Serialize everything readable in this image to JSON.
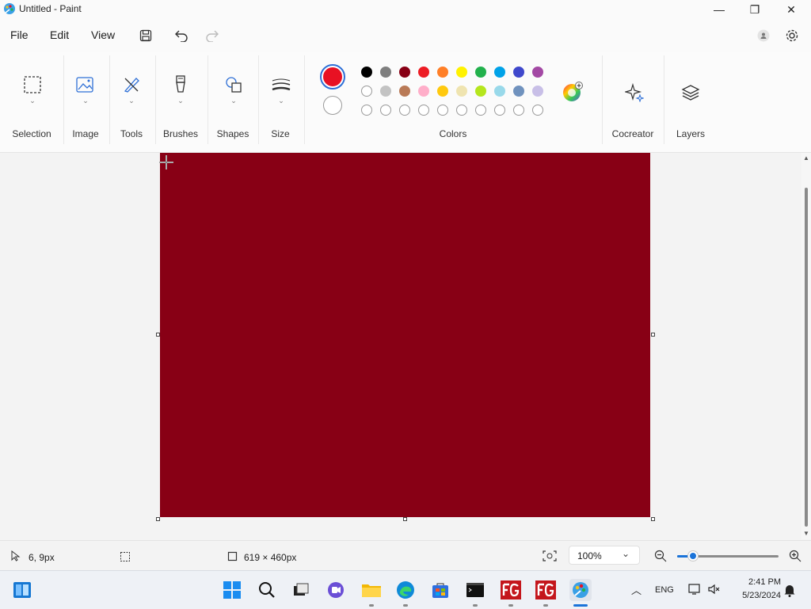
{
  "window": {
    "title": "Untitled - Paint",
    "minimize": "—",
    "restore": "❐",
    "close": "✕"
  },
  "menu": {
    "file": "File",
    "edit": "Edit",
    "view": "View"
  },
  "ribbon": {
    "groups": {
      "selection": "Selection",
      "image": "Image",
      "tools": "Tools",
      "brushes": "Brushes",
      "shapes": "Shapes",
      "size": "Size",
      "colors": "Colors",
      "cocreator": "Cocreator",
      "layers": "Layers"
    },
    "primary_color": "#e81123",
    "secondary_color": "#ffffff",
    "palette_row1": [
      "#000000",
      "#7f7f7f",
      "#880015",
      "#ed1c24",
      "#ff7f27",
      "#fff200",
      "#22b14c",
      "#00a2e8",
      "#3f48cc",
      "#a349a4"
    ],
    "palette_row2": [
      "#ffffff",
      "#c3c3c3",
      "#b97a57",
      "#ffaec9",
      "#ffc90e",
      "#efe4b0",
      "#b5e61d",
      "#99d9ea",
      "#7092be",
      "#c8bfe7"
    ],
    "palette_row3": [
      "",
      "",
      "",
      "",
      "",
      "",
      "",
      "",
      "",
      ""
    ]
  },
  "canvas": {
    "fill": "#880015"
  },
  "status": {
    "cursor_pos": "6, 9px",
    "canvas_size": "619 × 460px",
    "zoom": "100%"
  },
  "taskbar": {
    "time": "2:41 PM",
    "date": "5/23/2024",
    "lang": "ENG"
  }
}
